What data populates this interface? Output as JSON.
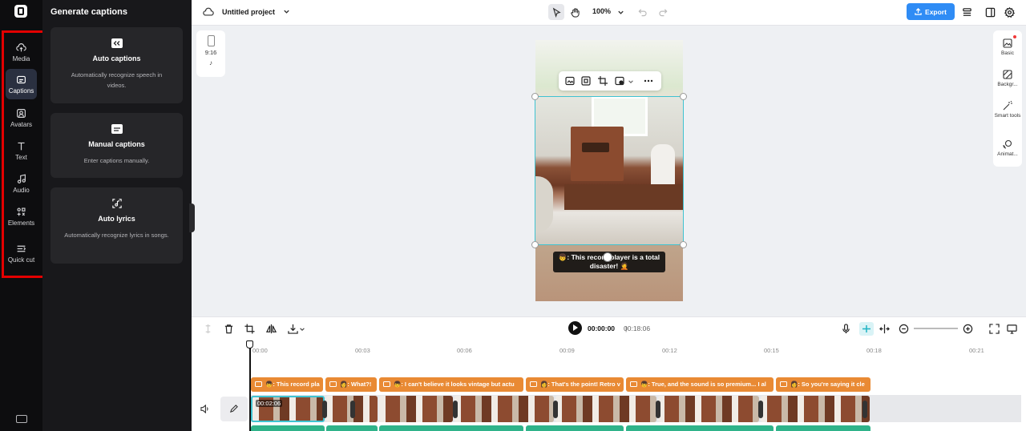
{
  "sidebar": {
    "items": [
      {
        "label": "Media"
      },
      {
        "label": "Captions"
      },
      {
        "label": "Avatars"
      },
      {
        "label": "Text"
      },
      {
        "label": "Audio"
      },
      {
        "label": "Elements"
      },
      {
        "label": "Quick cut"
      }
    ],
    "active": "Captions",
    "highlight_color": "#e30000"
  },
  "panel": {
    "title": "Generate captions",
    "cards": [
      {
        "title": "Auto captions",
        "desc": "Automatically recognize speech in videos."
      },
      {
        "title": "Manual captions",
        "desc": "Enter captions manually."
      },
      {
        "title": "Auto lyrics",
        "desc": "Automatically recognize lyrics in songs."
      }
    ]
  },
  "topbar": {
    "project_title": "Untitled project",
    "zoom": "100%",
    "export_label": "Export",
    "accent": "#2f8cf5"
  },
  "canvas": {
    "ratio": "9:16",
    "caption_text": "👦: This record player is a total disaster! 🤦"
  },
  "right_panel": {
    "items": [
      {
        "label": "Basic"
      },
      {
        "label": "Backgr..."
      },
      {
        "label": "Smart tools"
      },
      {
        "label": "Animat..."
      }
    ]
  },
  "timeline": {
    "current_time": "00:00:00",
    "duration": "00:18:06",
    "ruler": [
      "00:00",
      "00:03",
      "00:06",
      "00:09",
      "00:12",
      "00:15",
      "00:18",
      "00:21"
    ],
    "caption_segments": [
      "👦: This record pla",
      "👩: What?!",
      "👦: I can't believe it looks vintage but actu",
      "👩: That's the point! Retro v",
      "👦: True, and the sound is so premium... I al",
      "👩: So you're saying it cle"
    ],
    "first_clip_label": "00:02:06",
    "caption_color": "#e98a34",
    "audio_color": "#2fb38a"
  }
}
